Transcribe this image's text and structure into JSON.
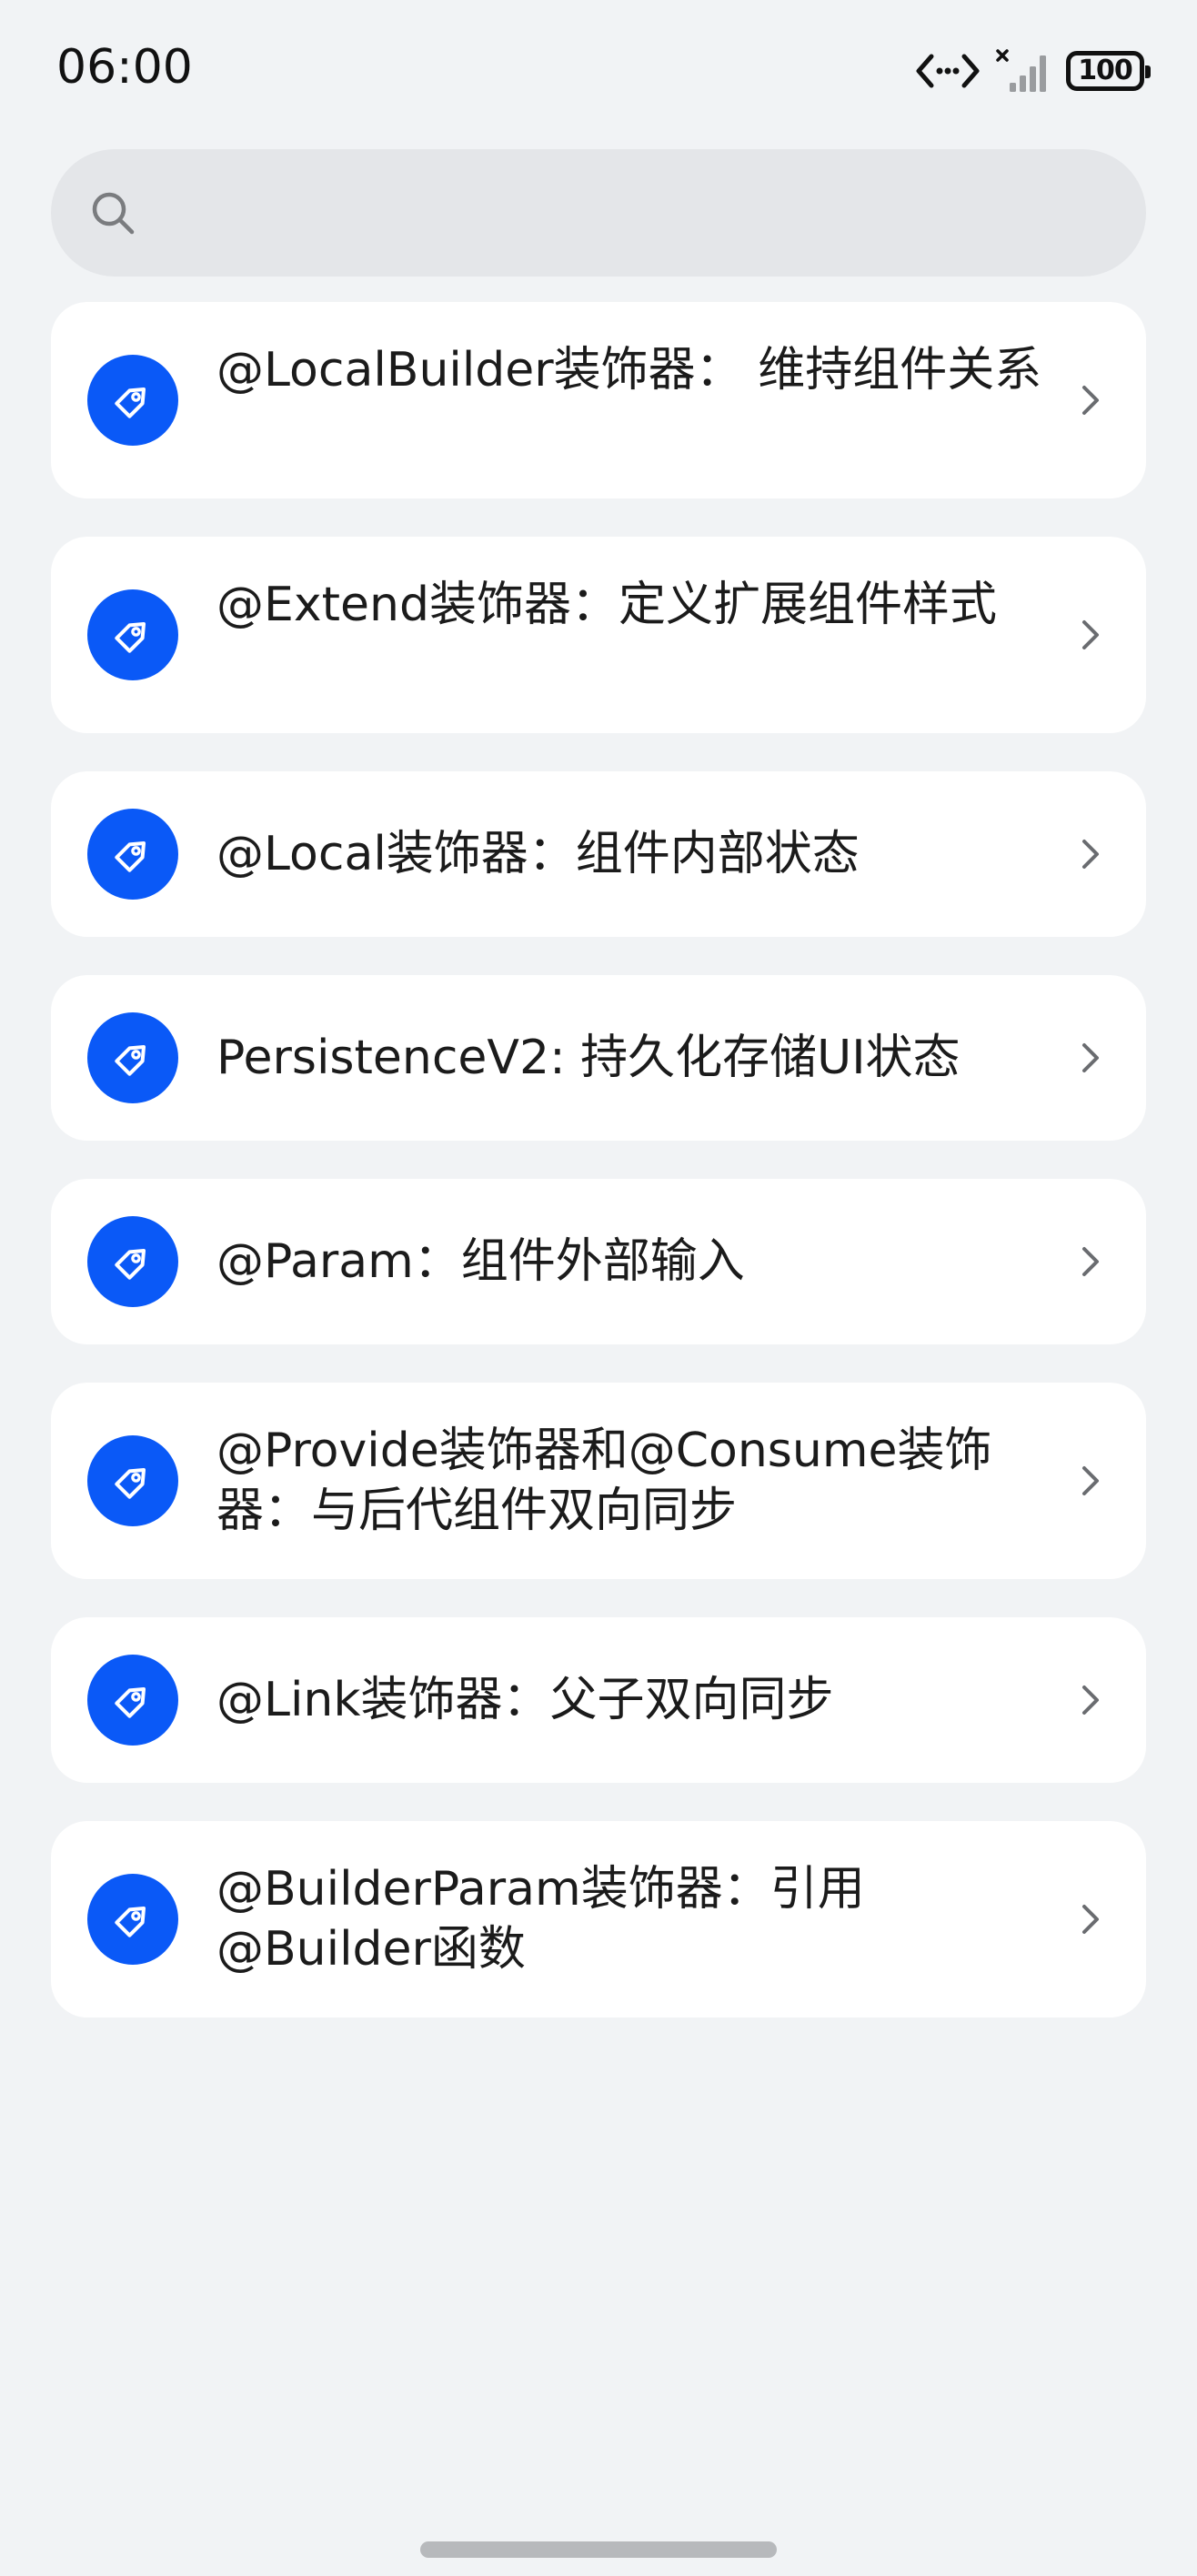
{
  "status_bar": {
    "time": "06:00",
    "battery": "100",
    "icons": [
      "connection-arrows-icon",
      "signal-no-service-icon",
      "battery-icon"
    ]
  },
  "search": {
    "placeholder": "",
    "value": ""
  },
  "list": {
    "items": [
      {
        "label": "@LocalBuilder装饰器： 维持组件关系",
        "icon": "tag-icon"
      },
      {
        "label": "@Extend装饰器：定义扩展组件样式",
        "icon": "tag-icon"
      },
      {
        "label": "@Local装饰器：组件内部状态",
        "icon": "tag-icon"
      },
      {
        "label": "PersistenceV2: 持久化存储UI状态",
        "icon": "tag-icon"
      },
      {
        "label": "@Param：组件外部输入",
        "icon": "tag-icon"
      },
      {
        "label": "@Provide装饰器和@Consume装饰器：与后代组件双向同步",
        "icon": "tag-icon"
      },
      {
        "label": "@Link装饰器：父子双向同步",
        "icon": "tag-icon"
      },
      {
        "label": "@BuilderParam装饰器：引用@Builder函数",
        "icon": "tag-icon"
      }
    ]
  },
  "colors": {
    "accent": "#0a59f7",
    "background": "#f1f3f5",
    "card": "#ffffff",
    "search_bg": "#e4e6e9"
  }
}
